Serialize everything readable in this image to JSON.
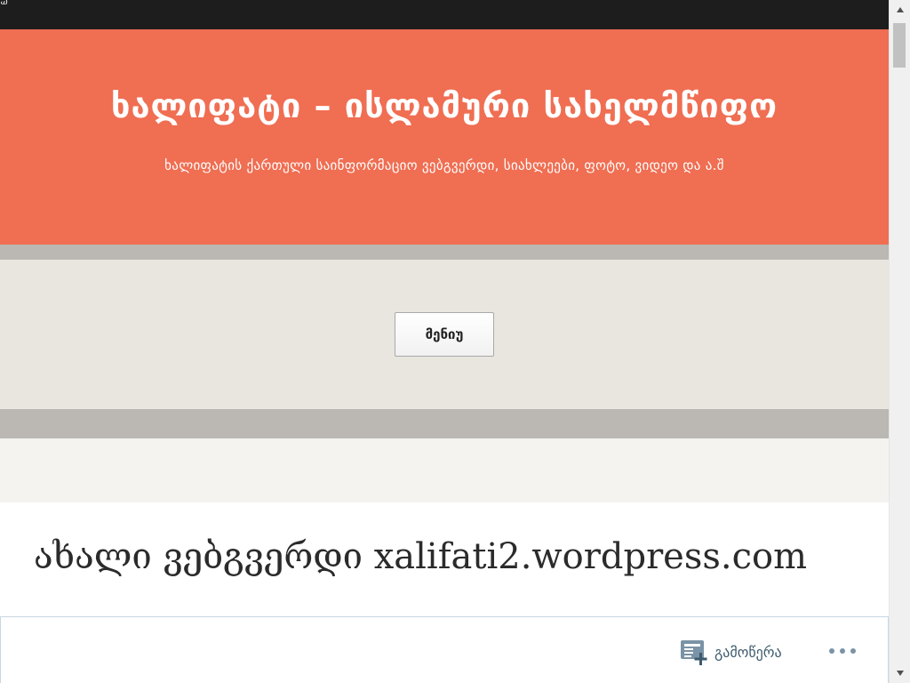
{
  "corner": {
    "glyph": "Ꮚ"
  },
  "header": {
    "site_title": "ხალიფატი – ისლამური სახელმწიფო",
    "tagline": "ხალიფატის ქართული საინფორმაციო ვებგვერდი, სიახლეები, ფოტო, ვიდეო და ა.შ",
    "background_color": "#f06e52"
  },
  "nav": {
    "menu_label": "მენიუ"
  },
  "post": {
    "title": "ახალი ვებგვერდი xalifati2.wordpress.com"
  },
  "action_bar": {
    "follow_label": "გამოწერა",
    "follow_icon": "reader-plus-icon",
    "more_icon": "ellipsis-icon"
  },
  "scrollbar": {
    "up_icon": "scroll-up-arrow-icon",
    "down_icon": "scroll-down-arrow-icon"
  }
}
